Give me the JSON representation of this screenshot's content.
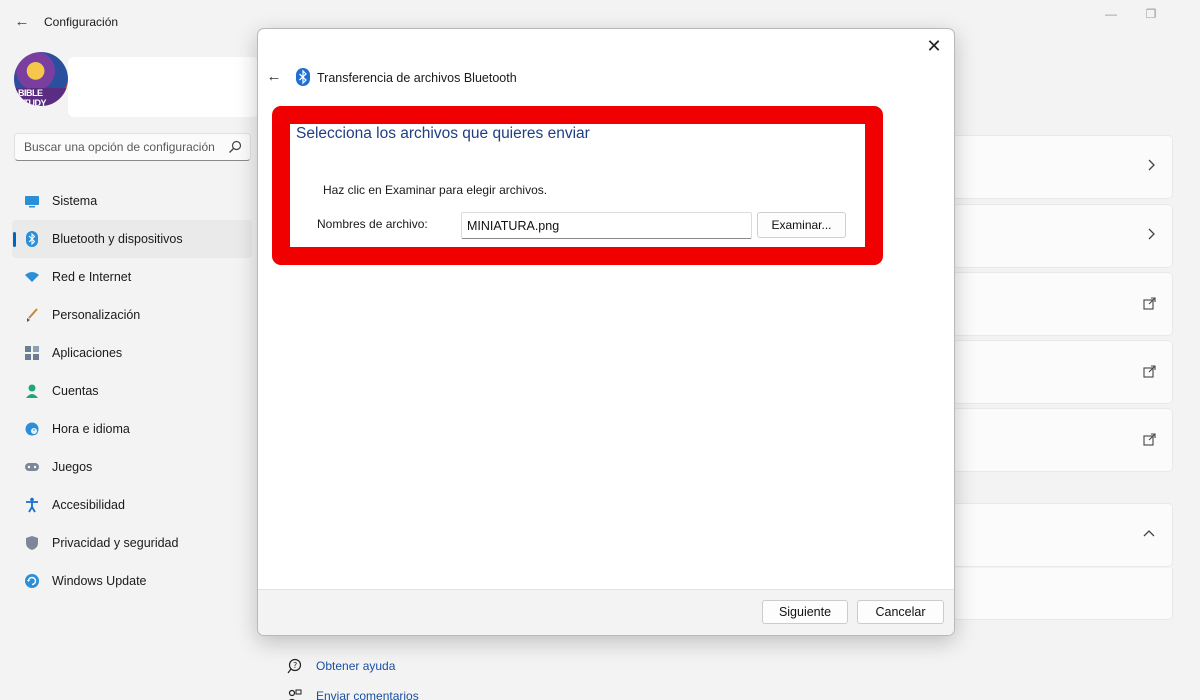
{
  "app": {
    "title": "Configuración"
  },
  "search": {
    "placeholder": "Buscar una opción de configuración"
  },
  "avatar": {
    "text": "BIBLE STUDY"
  },
  "sidebar": {
    "items": [
      {
        "label": "Sistema",
        "icon": "monitor-icon"
      },
      {
        "label": "Bluetooth y dispositivos",
        "icon": "bluetooth-icon",
        "active": true
      },
      {
        "label": "Red e Internet",
        "icon": "wifi-icon"
      },
      {
        "label": "Personalización",
        "icon": "brush-icon"
      },
      {
        "label": "Aplicaciones",
        "icon": "apps-icon"
      },
      {
        "label": "Cuentas",
        "icon": "person-icon"
      },
      {
        "label": "Hora e idioma",
        "icon": "clock-globe-icon"
      },
      {
        "label": "Juegos",
        "icon": "gamepad-icon"
      },
      {
        "label": "Accesibilidad",
        "icon": "accessibility-icon"
      },
      {
        "label": "Privacidad y seguridad",
        "icon": "shield-icon"
      },
      {
        "label": "Windows Update",
        "icon": "update-icon"
      }
    ]
  },
  "help": {
    "get_help": "Obtener ayuda",
    "send_feedback": "Enviar comentarios"
  },
  "dialog": {
    "title": "Transferencia de archivos Bluetooth",
    "heading": "Selecciona los archivos que quieres enviar",
    "instruction": "Haz clic en Examinar para elegir archivos.",
    "filename_label": "Nombres de archivo:",
    "filename_value": "MINIATURA.png",
    "browse_label": "Examinar...",
    "next_label": "Siguiente",
    "cancel_label": "Cancelar"
  },
  "colors": {
    "highlight": "#f00000",
    "accent": "#0067c0",
    "heading": "#1e3f82",
    "link": "#1a4fa0"
  }
}
